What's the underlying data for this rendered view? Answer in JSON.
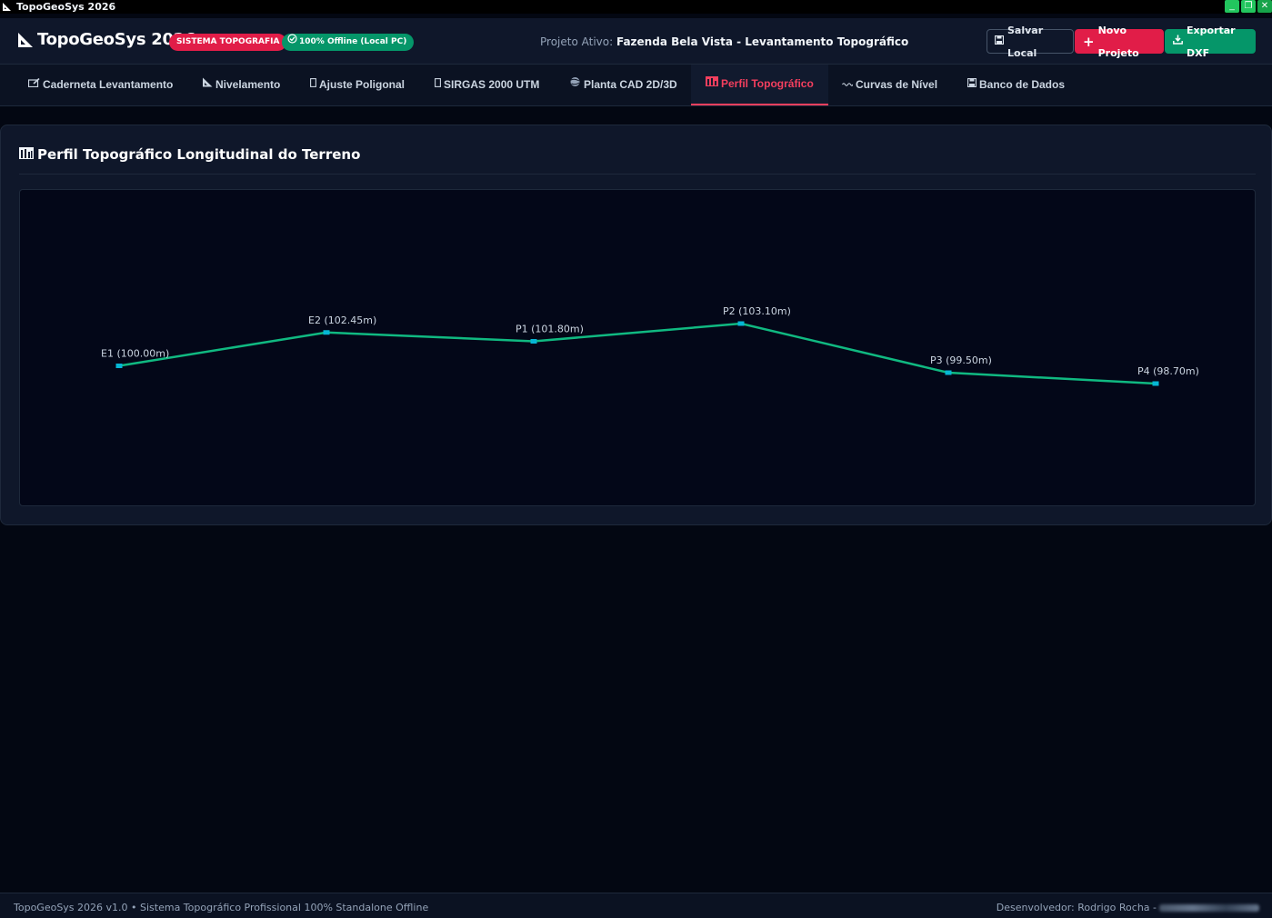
{
  "window": {
    "title": "TopoGeoSys 2026",
    "controls": [
      "_",
      "❐",
      "✕"
    ]
  },
  "header": {
    "brand": "TopoGeoSys 2026",
    "badge_system": "SISTEMA TOPOGRAFIA",
    "badge_offline": "100% Offline (Local PC)",
    "project_prefix": "Projeto Ativo:",
    "project_name": "Fazenda Bela Vista - Levantamento Topográfico",
    "buttons": {
      "save": "Salvar Local",
      "new": "Novo Projeto",
      "export": "Exportar DXF"
    }
  },
  "tabs": [
    {
      "label": "Caderneta Levantamento",
      "icon": "notebook-icon"
    },
    {
      "label": "Nivelamento",
      "icon": "triangle-ruler-icon"
    },
    {
      "label": "Ajuste Poligonal",
      "icon": "box-icon"
    },
    {
      "label": "SIRGAS 2000 UTM",
      "icon": "box-icon"
    },
    {
      "label": "Planta CAD 2D/3D",
      "icon": "globe-icon"
    },
    {
      "label": "Perfil Topográfico",
      "icon": "bar-chart-icon",
      "active": true
    },
    {
      "label": "Curvas de Nível",
      "icon": "wave-icon"
    },
    {
      "label": "Banco de Dados",
      "icon": "floppy-icon"
    }
  ],
  "panel": {
    "title": "Perfil Topográfico Longitudinal do Terreno"
  },
  "chart_data": {
    "type": "line",
    "title": "",
    "xlabel": "",
    "ylabel": "",
    "points": [
      {
        "label": "E1 (100.00m)",
        "name": "E1",
        "elevation": 100.0
      },
      {
        "label": "E2 (102.45m)",
        "name": "E2",
        "elevation": 102.45
      },
      {
        "label": "P1 (101.80m)",
        "name": "P1",
        "elevation": 101.8
      },
      {
        "label": "P2 (103.10m)",
        "name": "P2",
        "elevation": 103.1
      },
      {
        "label": "P3 (99.50m)",
        "name": "P3",
        "elevation": 99.5
      },
      {
        "label": "P4 (98.70m)",
        "name": "P4",
        "elevation": 98.7
      }
    ],
    "line_color": "#10b981",
    "marker_color": "#06b6d4",
    "label_color": "#cbd5e1",
    "grid": false
  },
  "footer": {
    "left": "TopoGeoSys 2026 v1.0 • Sistema Topográfico Profissional 100% Standalone Offline",
    "right": "Desenvolvedor: Rodrigo Rocha -"
  },
  "colors": {
    "accent_red": "#e11d48",
    "accent_green": "#059669",
    "background": "#030712"
  }
}
